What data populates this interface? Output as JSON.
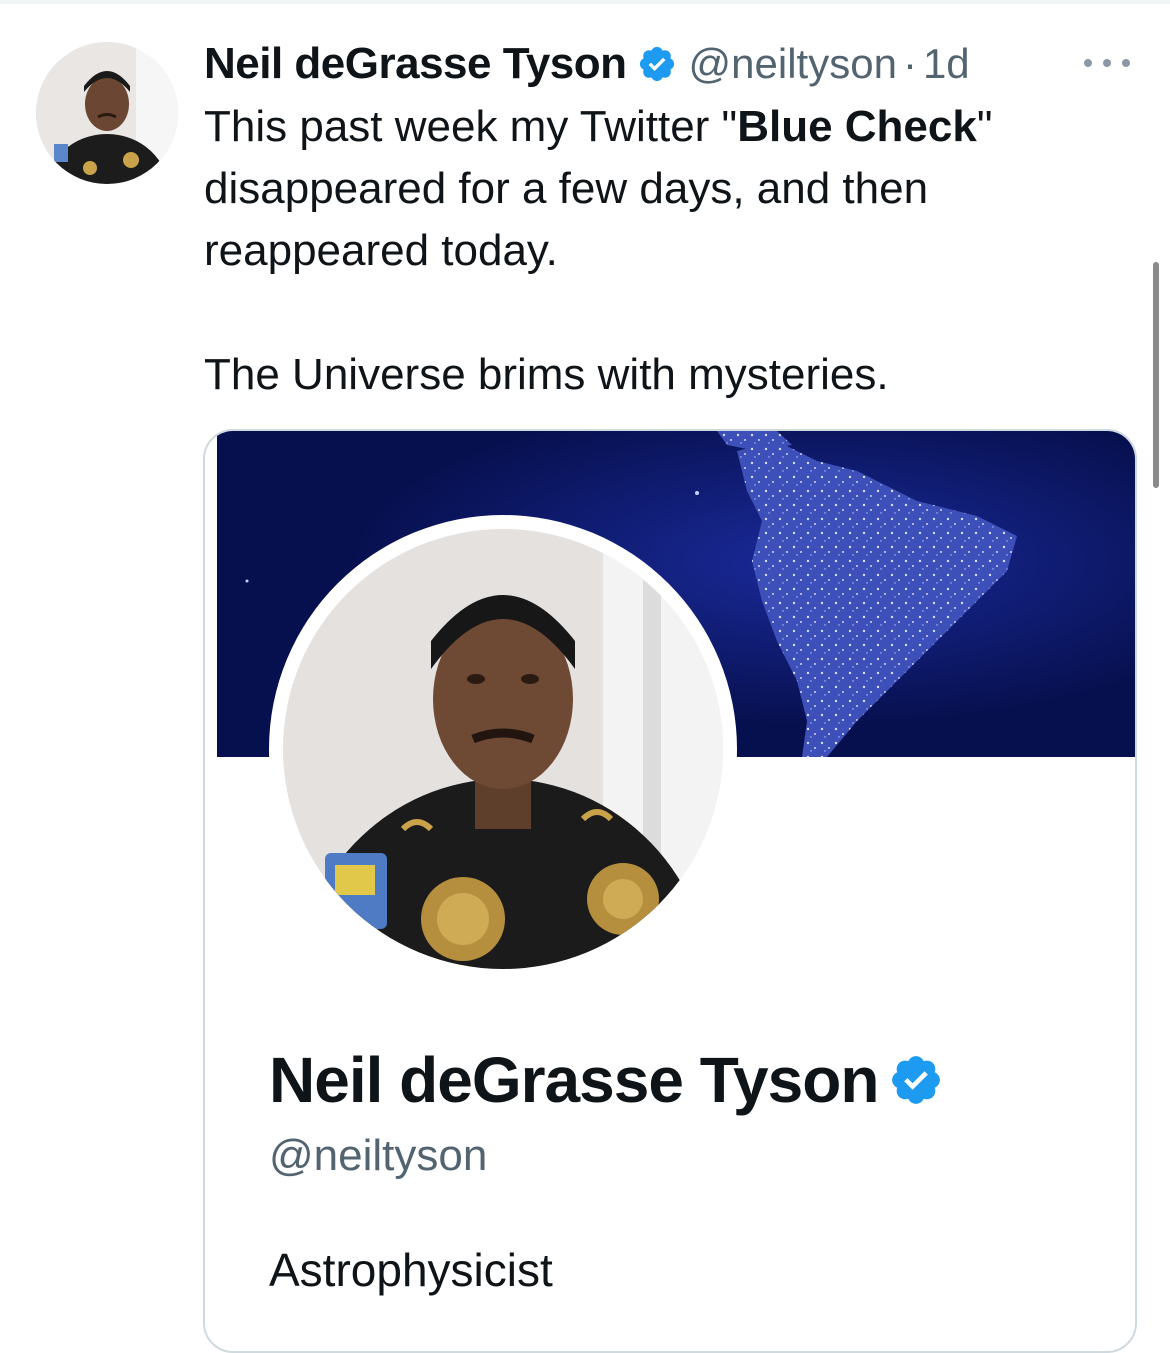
{
  "tweet": {
    "display_name": "Neil deGrasse Tyson",
    "handle": "@neiltyson",
    "separator": "·",
    "time": "1d",
    "text": {
      "line1_prefix": "This past week my Twitter \"",
      "line1_bold": "Blue Check",
      "line1_suffix": "\"",
      "line2": "disappeared for a few days, and then",
      "line3": "reappeared today.",
      "line4": "The Universe brims with mysteries."
    }
  },
  "profile_card": {
    "display_name": "Neil deGrasse Tyson",
    "handle": "@neiltyson",
    "bio": "Astrophysicist"
  },
  "icons": {
    "verified": "verified-badge-icon",
    "more": "more-options-icon"
  },
  "colors": {
    "verified_blue": "#1d9bf0",
    "secondary_text": "#536471",
    "banner_ocean": "#0a1463"
  }
}
